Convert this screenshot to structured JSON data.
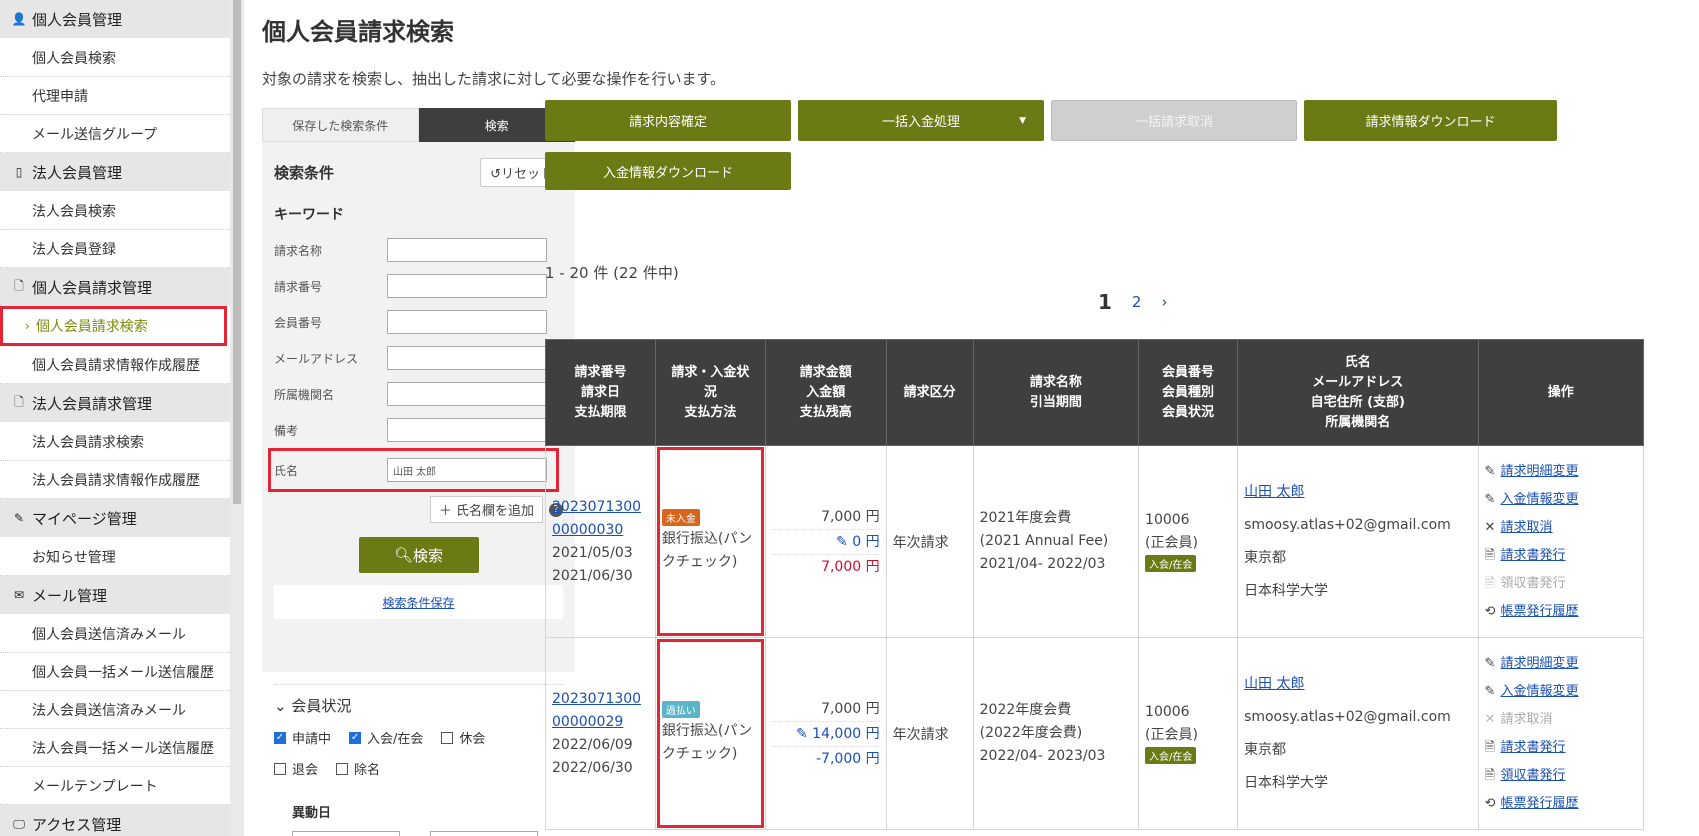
{
  "sidebar": {
    "sections": [
      {
        "icon": "person-icon",
        "glyph": "👤",
        "title": "個人会員管理",
        "items": [
          "個人会員検索",
          "代理申請",
          "メール送信グループ"
        ]
      },
      {
        "icon": "building-icon",
        "glyph": "▯",
        "title": "法人会員管理",
        "items": [
          "法人会員検索",
          "法人会員登録"
        ]
      },
      {
        "icon": "document-icon",
        "glyph": "🗋",
        "title": "個人会員請求管理",
        "items": [
          "個人会員請求検索",
          "個人会員請求情報作成履歴"
        ],
        "active": 0
      },
      {
        "icon": "document-icon",
        "glyph": "🗋",
        "title": "法人会員請求管理",
        "items": [
          "法人会員請求検索",
          "法人会員請求情報作成履歴"
        ]
      },
      {
        "icon": "pen-icon",
        "glyph": "✎",
        "title": "マイページ管理",
        "items": [
          "お知らせ管理"
        ]
      },
      {
        "icon": "mail-icon",
        "glyph": "✉",
        "title": "メール管理",
        "items": [
          "個人会員送信済みメール",
          "個人会員一括メール送信履歴",
          "法人会員送信済みメール",
          "法人会員一括メール送信履歴",
          "メールテンプレート"
        ]
      },
      {
        "icon": "monitor-icon",
        "glyph": "🖵",
        "title": "アクセス管理",
        "items": []
      }
    ]
  },
  "page": {
    "title": "個人会員請求検索",
    "description": "対象の請求を検索し、抽出した請求に対して必要な操作を行います。"
  },
  "panel": {
    "tab_saved": "保存した検索条件",
    "tab_search": "検索",
    "cond_title": "検索条件",
    "reset": "リセット",
    "keyword_title": "キーワード",
    "fields": [
      {
        "label": "請求名称",
        "value": ""
      },
      {
        "label": "請求番号",
        "value": ""
      },
      {
        "label": "会員番号",
        "value": ""
      },
      {
        "label": "メールアドレス",
        "value": ""
      },
      {
        "label": "所属機関名",
        "value": ""
      },
      {
        "label": "備考",
        "value": ""
      },
      {
        "label": "氏名",
        "value": "山田 太郎"
      }
    ],
    "add_name": "氏名欄を追加",
    "help": "?",
    "search_btn": "検索",
    "save_cond": "検索条件保存",
    "member_status_title": "会員状況",
    "statuses": [
      {
        "label": "申請中",
        "checked": true
      },
      {
        "label": "入会/在会",
        "checked": true
      },
      {
        "label": "休会",
        "checked": false
      },
      {
        "label": "退会",
        "checked": false
      },
      {
        "label": "除名",
        "checked": false
      }
    ],
    "ido_title": "異動日",
    "tilde": "～"
  },
  "actions": {
    "confirm": "請求内容確定",
    "bulk_payment": "一括入金処理",
    "bulk_cancel": "一括請求取消",
    "download_billing": "請求情報ダウンロード",
    "download_payment": "入金情報ダウンロード"
  },
  "results": {
    "count": "1 - 20 件 (22 件中)",
    "pages": [
      "1",
      "2",
      "›"
    ],
    "headers": [
      "請求番号\n請求日\n支払期限",
      "請求・入金状\n況\n支払方法",
      "請求金額\n入金額\n支払残高",
      "請求区分",
      "請求名称\n引当期間",
      "会員番号\n会員種別\n会員状況",
      "氏名\nメールアドレス\n自宅住所 (支部)\n所属機関名",
      "操作"
    ],
    "rows": [
      {
        "number_line1": "2023071300",
        "number_line2": "00000030",
        "billing_date": "2021/05/03",
        "due_date": "2021/06/30",
        "status_badge": "未入金",
        "status_color": "#d9641c",
        "payment_method": "銀行振込(パンクチェック)",
        "amount": "7,000 円",
        "paid": "0 円",
        "balance": "7,000 円",
        "category": "年次請求",
        "name_line1": "2021年度会費",
        "name_line2": "(2021 Annual Fee)",
        "period": "2021/04- 2022/03",
        "member_no": "10006",
        "member_type": "(正会員)",
        "member_status": "入会/在会",
        "person": "山田 太郎",
        "email": "smoosy.atlas+02@gmail.com",
        "address": "東京都",
        "org": "日本科学大学",
        "ops": [
          "請求明細変更",
          "入金情報変更",
          "請求取消",
          "請求書発行",
          "領収書発行",
          "帳票発行履歴"
        ]
      },
      {
        "number_line1": "2023071300",
        "number_line2": "00000029",
        "billing_date": "2022/06/09",
        "due_date": "2022/06/30",
        "status_badge": "過払い",
        "status_color": "#5ab5c9",
        "payment_method": "銀行振込(パンクチェック)",
        "amount": "7,000 円",
        "paid": "14,000 円",
        "balance": "-7,000 円",
        "category": "年次請求",
        "name_line1": "2022年度会費",
        "name_line2": "(2022年度会費)",
        "period": "2022/04- 2023/03",
        "member_no": "10006",
        "member_type": "(正会員)",
        "member_status": "入会/在会",
        "person": "山田 太郎",
        "email": "smoosy.atlas+02@gmail.com",
        "address": "東京都",
        "org": "日本科学大学",
        "ops": [
          "請求明細変更",
          "入金情報変更",
          "請求取消",
          "請求書発行",
          "領収書発行",
          "帳票発行履歴"
        ]
      }
    ]
  },
  "colors": {
    "accent": "#6b7a14",
    "highlight": "#e32636",
    "link": "#1a4fb5"
  }
}
